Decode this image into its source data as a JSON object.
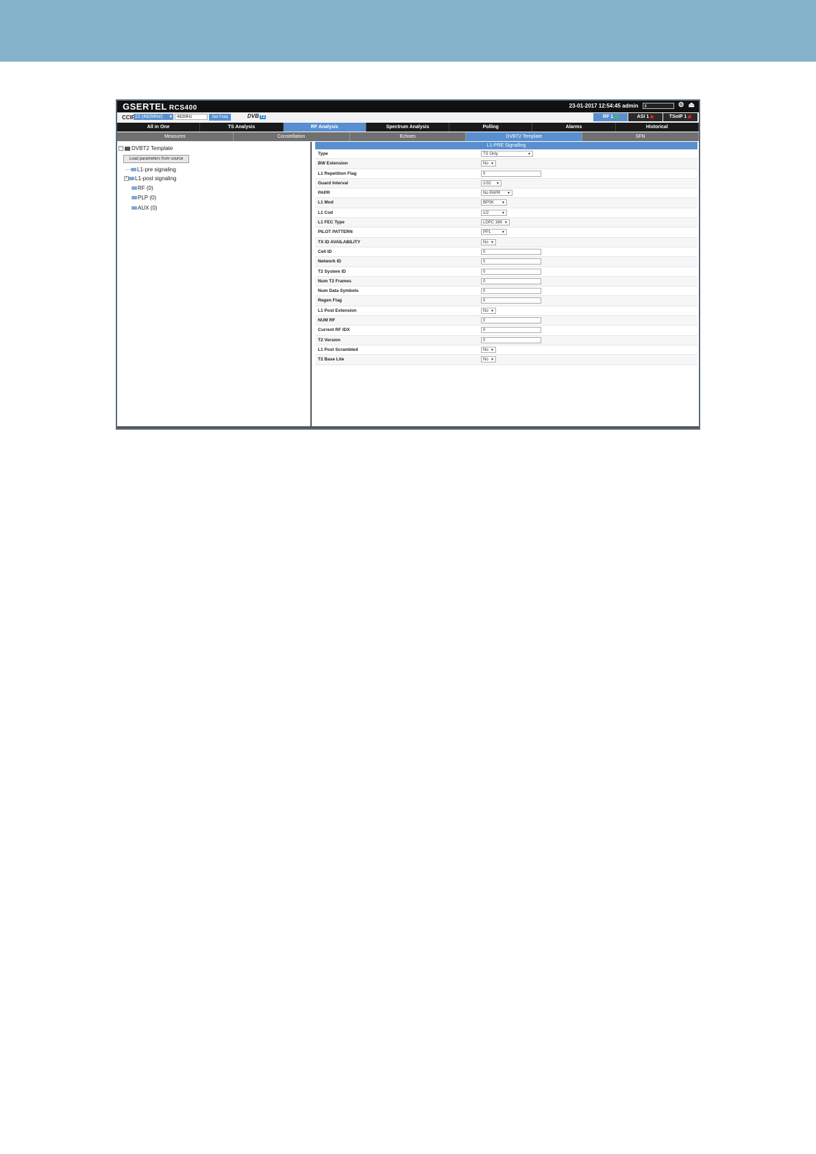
{
  "header": {
    "brand": "GSERTEL",
    "model": "RCS400",
    "datetime_user": "23-01-2017 12:54:45 admin",
    "box_left": "",
    "box_right": ""
  },
  "freqbar": {
    "ccir_label": "CCIR",
    "ccir_value": "22 (482MHz)",
    "freq_value": "482MHz",
    "set_freq_label": "Set Freq",
    "dvb_label": "DVB",
    "dvb_badge": "T2",
    "status_tabs": [
      {
        "label": "RF 1",
        "status_color": "#3cc83c"
      },
      {
        "label": "ASI 1",
        "status_color": "#e02020"
      },
      {
        "label": "TSoIP 1",
        "status_color": "#e02020"
      }
    ]
  },
  "main_nav": [
    "All in One",
    "TS Analysis",
    "RF Analysis",
    "Spectrum Analysis",
    "Polling",
    "Alarms",
    "Historical"
  ],
  "main_nav_active": "RF Analysis",
  "sub_nav": [
    "Measures",
    "Constellation",
    "Echoes",
    "DVBT2 Template",
    "SFN"
  ],
  "sub_nav_active": "DVBT2 Template",
  "tree": {
    "root_label": "DVBT2 Template",
    "load_button": "Load parameters from source",
    "nodes": [
      "L1-pre signaling",
      "L1-post signaling",
      "RF (0)",
      "PLP (0)",
      "AUX (0)"
    ]
  },
  "form": {
    "header": "L1-PRE Signalling",
    "rows": [
      {
        "label": "Type",
        "value": "TS Only",
        "kind": "select"
      },
      {
        "label": "BW Extension",
        "value": "No",
        "kind": "select"
      },
      {
        "label": "L1 Repetition Flag",
        "value": "0",
        "kind": "input"
      },
      {
        "label": "Guard Interval",
        "value": "1/32",
        "kind": "select"
      },
      {
        "label": "PAPR",
        "value": "No PAPR",
        "kind": "select"
      },
      {
        "label": "L1 Mod",
        "value": "BPSK",
        "kind": "select"
      },
      {
        "label": "L1 Cod",
        "value": "1/2",
        "kind": "select"
      },
      {
        "label": "L1 FEC Type",
        "value": "LDPC 16K",
        "kind": "select"
      },
      {
        "label": "PILOT PATTERN",
        "value": "PP1",
        "kind": "select"
      },
      {
        "label": "TX ID AVAILABILITY",
        "value": "No",
        "kind": "select"
      },
      {
        "label": "Cell ID",
        "value": "0",
        "kind": "input"
      },
      {
        "label": "Network ID",
        "value": "0",
        "kind": "input"
      },
      {
        "label": "T2 System ID",
        "value": "0",
        "kind": "input"
      },
      {
        "label": "Num T2 Frames",
        "value": "0",
        "kind": "input"
      },
      {
        "label": "Num Data Symbols",
        "value": "0",
        "kind": "input"
      },
      {
        "label": "Regen Flag",
        "value": "0",
        "kind": "input"
      },
      {
        "label": "L1 Post Extension",
        "value": "No",
        "kind": "select"
      },
      {
        "label": "NUM RF",
        "value": "0",
        "kind": "input"
      },
      {
        "label": "Current RF IDX",
        "value": "0",
        "kind": "input"
      },
      {
        "label": "T2 Version",
        "value": "0",
        "kind": "input"
      },
      {
        "label": "L1 Post Scrambled",
        "value": "No",
        "kind": "select"
      },
      {
        "label": "T2 Base Lite",
        "value": "No",
        "kind": "select"
      }
    ]
  },
  "colors": {
    "banner": "#86b3cc",
    "accent": "#5a8fcf"
  }
}
